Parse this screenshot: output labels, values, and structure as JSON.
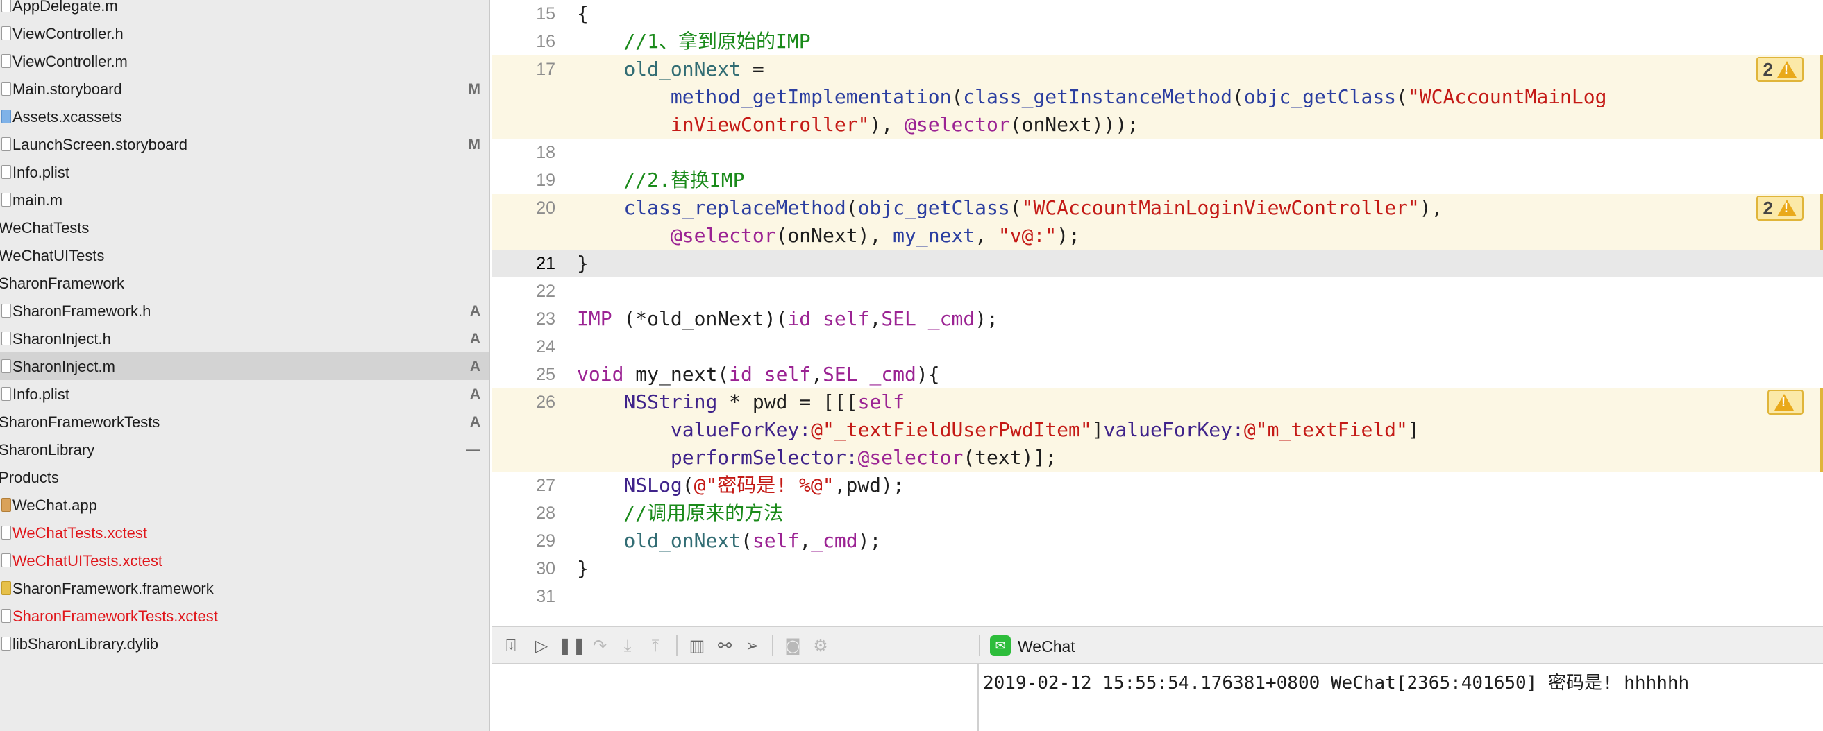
{
  "navigator": {
    "items": [
      {
        "label": "AppDelegate.m",
        "badge": "",
        "icon": "file",
        "color": "normal"
      },
      {
        "label": "ViewController.h",
        "badge": "",
        "icon": "file",
        "color": "normal"
      },
      {
        "label": "ViewController.m",
        "badge": "",
        "icon": "file",
        "color": "normal"
      },
      {
        "label": "Main.storyboard",
        "badge": "M",
        "icon": "file",
        "color": "normal"
      },
      {
        "label": "Assets.xcassets",
        "badge": "",
        "icon": "folder",
        "color": "normal"
      },
      {
        "label": "LaunchScreen.storyboard",
        "badge": "M",
        "icon": "file",
        "color": "normal"
      },
      {
        "label": "Info.plist",
        "badge": "",
        "icon": "file",
        "color": "normal"
      },
      {
        "label": "main.m",
        "badge": "",
        "icon": "file",
        "color": "normal"
      },
      {
        "label": "WeChatTests",
        "badge": "",
        "icon": "none",
        "color": "normal"
      },
      {
        "label": "WeChatUITests",
        "badge": "",
        "icon": "none",
        "color": "normal"
      },
      {
        "label": "SharonFramework",
        "badge": "",
        "icon": "none",
        "color": "normal"
      },
      {
        "label": "SharonFramework.h",
        "badge": "A",
        "icon": "file",
        "color": "normal"
      },
      {
        "label": "SharonInject.h",
        "badge": "A",
        "icon": "file",
        "color": "normal"
      },
      {
        "label": "SharonInject.m",
        "badge": "A",
        "icon": "file",
        "color": "normal"
      },
      {
        "label": "Info.plist",
        "badge": "A",
        "icon": "file",
        "color": "normal"
      },
      {
        "label": "SharonFrameworkTests",
        "badge": "A",
        "icon": "none",
        "color": "normal"
      },
      {
        "label": "SharonLibrary",
        "badge": "—",
        "icon": "none",
        "color": "normal"
      },
      {
        "label": "Products",
        "badge": "",
        "icon": "none",
        "color": "normal"
      },
      {
        "label": "WeChat.app",
        "badge": "",
        "icon": "app",
        "color": "normal"
      },
      {
        "label": "WeChatTests.xctest",
        "badge": "",
        "icon": "file",
        "color": "red"
      },
      {
        "label": "WeChatUITests.xctest",
        "badge": "",
        "icon": "file",
        "color": "red"
      },
      {
        "label": "SharonFramework.framework",
        "badge": "",
        "icon": "fw",
        "color": "normal"
      },
      {
        "label": "SharonFrameworkTests.xctest",
        "badge": "",
        "icon": "file",
        "color": "red"
      },
      {
        "label": "libSharonLibrary.dylib",
        "badge": "",
        "icon": "file",
        "color": "normal"
      }
    ],
    "selected_index": 13
  },
  "editor": {
    "current_line": "21",
    "lines": [
      {
        "num": "15",
        "segments": [
          [
            "{",
            "plain"
          ]
        ]
      },
      {
        "num": "16",
        "segments": [
          [
            "    //1、拿到原始的IMP",
            "comment"
          ]
        ]
      },
      {
        "num": "17",
        "segments": [
          [
            "    ",
            "plain"
          ],
          [
            "old_onNext",
            "var"
          ],
          [
            " =",
            "plain"
          ]
        ],
        "warning": "2"
      },
      {
        "num": "",
        "segments": [
          [
            "        ",
            "plain"
          ],
          [
            "method_getImplementation",
            "fn"
          ],
          [
            "(",
            "plain"
          ],
          [
            "class_getInstanceMethod",
            "fn"
          ],
          [
            "(",
            "plain"
          ],
          [
            "objc_getClass",
            "fn"
          ],
          [
            "(",
            "plain"
          ],
          [
            "\"WCAccountMainLog",
            "str"
          ]
        ]
      },
      {
        "num": "",
        "segments": [
          [
            "        ",
            "plain"
          ],
          [
            "inViewController\"",
            "str"
          ],
          [
            "), ",
            "plain"
          ],
          [
            "@selector",
            "kw"
          ],
          [
            "(onNext)));",
            "plain"
          ]
        ]
      },
      {
        "num": "18",
        "segments": [
          [
            "",
            "plain"
          ]
        ]
      },
      {
        "num": "19",
        "segments": [
          [
            "    //2.替换IMP",
            "comment"
          ]
        ]
      },
      {
        "num": "20",
        "segments": [
          [
            "    ",
            "plain"
          ],
          [
            "class_replaceMethod",
            "fn"
          ],
          [
            "(",
            "plain"
          ],
          [
            "objc_getClass",
            "fn"
          ],
          [
            "(",
            "plain"
          ],
          [
            "\"WCAccountMainLoginViewController\"",
            "str"
          ],
          [
            "),",
            "plain"
          ]
        ],
        "warning": "2"
      },
      {
        "num": "",
        "segments": [
          [
            "        ",
            "plain"
          ],
          [
            "@selector",
            "kw"
          ],
          [
            "(onNext), ",
            "plain"
          ],
          [
            "my_next",
            "fn"
          ],
          [
            ", ",
            "plain"
          ],
          [
            "\"v@:\"",
            "str"
          ],
          [
            ");",
            "plain"
          ]
        ]
      },
      {
        "num": "21",
        "segments": [
          [
            "}",
            "plain"
          ]
        ]
      },
      {
        "num": "22",
        "segments": [
          [
            "",
            "plain"
          ]
        ]
      },
      {
        "num": "23",
        "segments": [
          [
            "IMP",
            "kw"
          ],
          [
            " (*old_onNext)(",
            "plain"
          ],
          [
            "id",
            "kw"
          ],
          [
            " ",
            "plain"
          ],
          [
            "self",
            "kw"
          ],
          [
            ",",
            "plain"
          ],
          [
            "SEL",
            "kw"
          ],
          [
            " ",
            "plain"
          ],
          [
            "_cmd",
            "kw"
          ],
          [
            ");",
            "plain"
          ]
        ]
      },
      {
        "num": "24",
        "segments": [
          [
            "",
            "plain"
          ]
        ]
      },
      {
        "num": "25",
        "segments": [
          [
            "void",
            "kw"
          ],
          [
            " my_next(",
            "plain"
          ],
          [
            "id",
            "kw"
          ],
          [
            " ",
            "plain"
          ],
          [
            "self",
            "kw"
          ],
          [
            ",",
            "plain"
          ],
          [
            "SEL",
            "kw"
          ],
          [
            " ",
            "plain"
          ],
          [
            "_cmd",
            "kw"
          ],
          [
            "){",
            "plain"
          ]
        ]
      },
      {
        "num": "26",
        "segments": [
          [
            "    ",
            "plain"
          ],
          [
            "NSString",
            "type"
          ],
          [
            " * pwd = [[[",
            "plain"
          ],
          [
            "self",
            "kw"
          ]
        ],
        "warning": ""
      },
      {
        "num": "",
        "segments": [
          [
            "        ",
            "plain"
          ],
          [
            "valueForKey:",
            "type"
          ],
          [
            "@\"_textFieldUserPwdItem\"",
            "str"
          ],
          [
            "]",
            "plain"
          ],
          [
            "valueForKey:",
            "type"
          ],
          [
            "@\"m_textField\"",
            "str"
          ],
          [
            "]",
            "plain"
          ]
        ]
      },
      {
        "num": "",
        "segments": [
          [
            "        ",
            "plain"
          ],
          [
            "performSelector:",
            "type"
          ],
          [
            "@selector",
            "kw"
          ],
          [
            "(text)];",
            "plain"
          ]
        ]
      },
      {
        "num": "27",
        "segments": [
          [
            "    ",
            "plain"
          ],
          [
            "NSLog",
            "type"
          ],
          [
            "(",
            "plain"
          ],
          [
            "@\"密码是! %@\"",
            "str"
          ],
          [
            ",pwd);",
            "plain"
          ]
        ]
      },
      {
        "num": "28",
        "segments": [
          [
            "    //调用原来的方法",
            "comment"
          ]
        ]
      },
      {
        "num": "29",
        "segments": [
          [
            "    ",
            "plain"
          ],
          [
            "old_onNext",
            "var"
          ],
          [
            "(",
            "plain"
          ],
          [
            "self",
            "kw"
          ],
          [
            ",",
            "plain"
          ],
          [
            "_cmd",
            "kw"
          ],
          [
            ");",
            "plain"
          ]
        ]
      },
      {
        "num": "30",
        "segments": [
          [
            "}",
            "plain"
          ]
        ]
      },
      {
        "num": "31",
        "segments": [
          [
            "",
            "plain"
          ]
        ]
      }
    ]
  },
  "debug_bar": {
    "process_name": "WeChat",
    "icons": [
      "hide-debug-area-icon",
      "breakpoint-toggle-icon",
      "pause-icon",
      "step-over-icon",
      "step-into-icon",
      "step-out-icon",
      "view-debugger-icon",
      "memory-graph-icon",
      "location-icon",
      "camera-icon",
      "gear-icon"
    ]
  },
  "console": {
    "output": "2019-02-12 15:55:54.176381+0800 WeChat[2365:401650] 密码是! hhhhhh"
  },
  "colors": {
    "highlight_band": "#fcf7e4",
    "current_line_band": "#e8e8e8",
    "warning": "#e9a91a",
    "red_file": "#e0161b"
  }
}
